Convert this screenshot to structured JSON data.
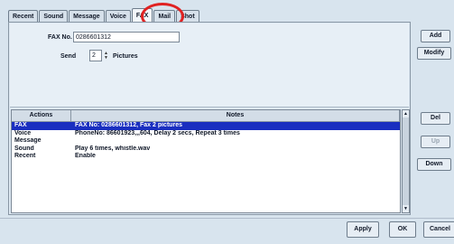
{
  "tabs": [
    {
      "label": "Recent"
    },
    {
      "label": "Sound"
    },
    {
      "label": "Message"
    },
    {
      "label": "Voice"
    },
    {
      "label": "FAX"
    },
    {
      "label": "Mail"
    },
    {
      "label": "Shot"
    }
  ],
  "active_tab": "FAX",
  "form": {
    "fax_label": "FAX No.",
    "fax_value": "0286601312",
    "send_label": "Send",
    "send_value": "2",
    "pictures_label": "Pictures"
  },
  "table": {
    "columns": [
      "Actions",
      "Notes"
    ],
    "rows": [
      {
        "action": "FAX",
        "note": "FAX No: 0286601312, Fax 2 pictures",
        "selected": true
      },
      {
        "action": "Voice",
        "note": "PhoneNo: 86601923,,,604, Delay 2 secs, Repeat 3 times",
        "selected": false
      },
      {
        "action": "Message",
        "note": "",
        "selected": false
      },
      {
        "action": "Sound",
        "note": "Play 6 times, whistle.wav",
        "selected": false
      },
      {
        "action": "Recent",
        "note": "Enable",
        "selected": false
      }
    ]
  },
  "side_buttons": {
    "add": "Add",
    "modify": "Modify",
    "del": "Del",
    "up": "Up",
    "down": "Down"
  },
  "footer": {
    "apply": "Apply",
    "ok": "OK",
    "cancel": "Cancel"
  },
  "colors": {
    "selection": "#1a2fc0",
    "highlight_circle": "#e02222"
  },
  "icons": {
    "spin": "spin-arrows-icon",
    "scroll_up": "scroll-up-arrow-icon",
    "scroll_down": "scroll-down-arrow-icon"
  }
}
